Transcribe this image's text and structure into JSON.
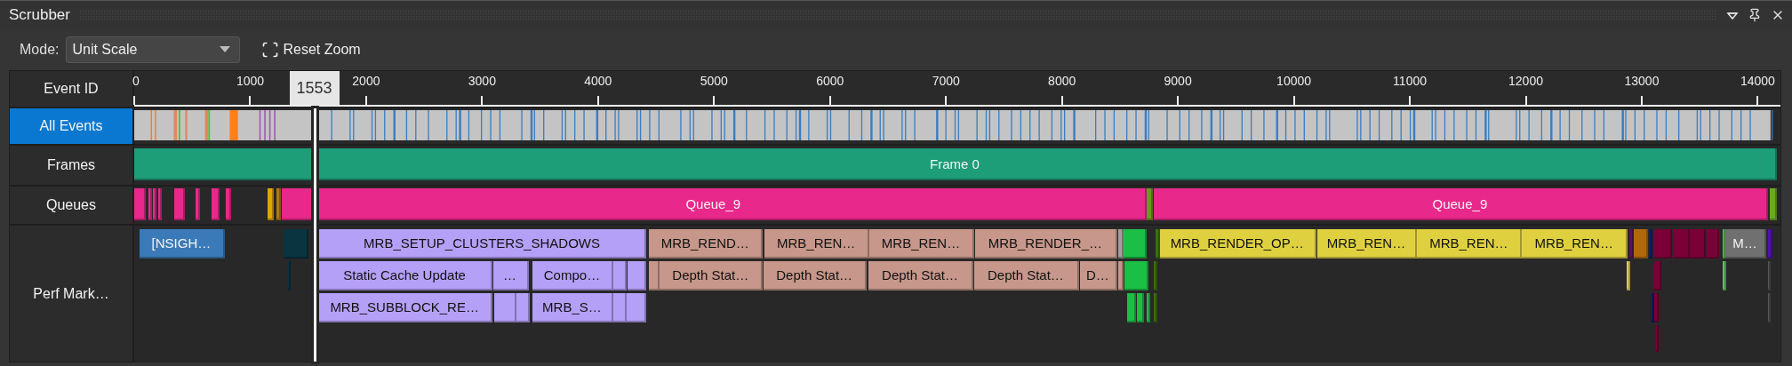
{
  "panel": {
    "title": "Scrubber"
  },
  "toolbar": {
    "mode_label": "Mode:",
    "mode_value": "Unit Scale",
    "reset_button": "Reset Zoom"
  },
  "timeline": {
    "header_label": "Event ID",
    "ticks": [
      "0",
      "1000",
      "2000",
      "3000",
      "4000",
      "5000",
      "6000",
      "7000",
      "8000",
      "9000",
      "10000",
      "11000",
      "12000",
      "13000",
      "14000"
    ],
    "scrubber": "1553",
    "lanes": [
      {
        "kind": "events",
        "label": "All Events",
        "selected": true
      },
      {
        "kind": "frames",
        "label": "Frames",
        "selected": false,
        "blocks": [
          {
            "label": "Frame 0",
            "color": "#1d9d78"
          }
        ]
      },
      {
        "kind": "queues",
        "label": "Queues",
        "selected": false,
        "blocks": [
          {
            "color": "#e8288a"
          },
          {
            "color": "#e8288a"
          },
          {
            "color": "#e8288a"
          },
          {
            "color": "#e8288a"
          },
          {
            "color": "#e8288a"
          },
          {
            "color": "#e8288a"
          },
          {
            "color": "#e8288a"
          },
          {
            "color": "#e8288a"
          },
          {
            "color": "#dea600"
          },
          {
            "color": "#b07a1a"
          },
          {
            "label": "Queue_9",
            "color": "#e8288a"
          },
          {
            "color": "#6a9a20"
          },
          {
            "label": "Queue_9",
            "color": "#e8288a"
          },
          {
            "color": "#6aaa20"
          }
        ]
      },
      {
        "kind": "markers",
        "label": "Perf Mark…",
        "selected": false,
        "rows": [
          {
            "blocks": [
              {
                "label": "[NSIGH…",
                "color": "#3a7ab8"
              },
              {
                "color": "#0b3441"
              },
              {
                "label": "MRB_SETUP_CLUSTERS_SHADOWS",
                "color": "#b4a0f6"
              },
              {
                "label": "MRB_REND…",
                "color": "#c6978a"
              },
              {
                "label": "MRB_REN…",
                "color": "#c6978a"
              },
              {
                "label": "MRB_REN…",
                "color": "#c6978a"
              },
              {
                "label": "MRB_RENDER_…",
                "color": "#c6978a"
              },
              {
                "color": "#a0a0a0"
              },
              {
                "color": "#1cbf45"
              },
              {
                "color": "#3a7010"
              },
              {
                "label": "MRB_RENDER_OP…",
                "color": "#dfd040"
              },
              {
                "label": "MRB_REN…",
                "color": "#dfd040"
              },
              {
                "label": "MRB_REN…",
                "color": "#dfd040"
              },
              {
                "label": "MRB_REN…",
                "color": "#dfd040"
              },
              {
                "color": "#5a1060"
              },
              {
                "color": "#b0680a"
              },
              {
                "color": "#102060"
              },
              {
                "color": "#7a0038"
              },
              {
                "color": "#7a0038"
              },
              {
                "color": "#7a0038"
              },
              {
                "color": "#7a0038"
              },
              {
                "color": "#60c060"
              },
              {
                "label": "M…",
                "color": "#707070"
              },
              {
                "color": "#5010b0"
              }
            ]
          },
          {
            "blocks": [
              {
                "color": "#0b3441"
              },
              {
                "label": "Static Cache Update",
                "color": "#b4a0f6"
              },
              {
                "label": "…",
                "color": "#b4a0f6"
              },
              {
                "label": "Compo…",
                "color": "#b4a0f6"
              },
              {
                "color": "#b4a0f6"
              },
              {
                "color": "#b4a0f6"
              },
              {
                "color": "#c6978a"
              },
              {
                "label": "Depth Stat…",
                "color": "#c6978a"
              },
              {
                "label": "Depth Stat…",
                "color": "#c6978a"
              },
              {
                "label": "Depth Stat…",
                "color": "#c6978a"
              },
              {
                "label": "Depth Stat…",
                "color": "#c6978a"
              },
              {
                "label": "D…",
                "color": "#c6978a"
              },
              {
                "color": "#c6978a"
              },
              {
                "color": "#1cbf45"
              },
              {
                "color": "#3a7010"
              },
              {
                "color": "#dfd040"
              },
              {
                "color": "#7a0038"
              },
              {
                "color": "#60c060"
              },
              {
                "color": "#555555"
              }
            ]
          },
          {
            "blocks": [
              {
                "label": "MRB_SUBBLOCK_RE…",
                "color": "#b4a0f6"
              },
              {
                "color": "#b4a0f6"
              },
              {
                "color": "#b4a0f6"
              },
              {
                "label": "MRB_S…",
                "color": "#b4a0f6"
              },
              {
                "color": "#b4a0f6"
              },
              {
                "color": "#b4a0f6"
              },
              {
                "color": "#1cbf45"
              },
              {
                "color": "#1cbf45"
              },
              {
                "color": "#1cbf45"
              },
              {
                "color": "#3a7010"
              },
              {
                "color": "#102060"
              },
              {
                "color": "#7a0038"
              },
              {
                "color": "#555555"
              }
            ]
          },
          {
            "blocks": [
              {
                "color": "#7a0038"
              }
            ]
          }
        ]
      }
    ]
  }
}
